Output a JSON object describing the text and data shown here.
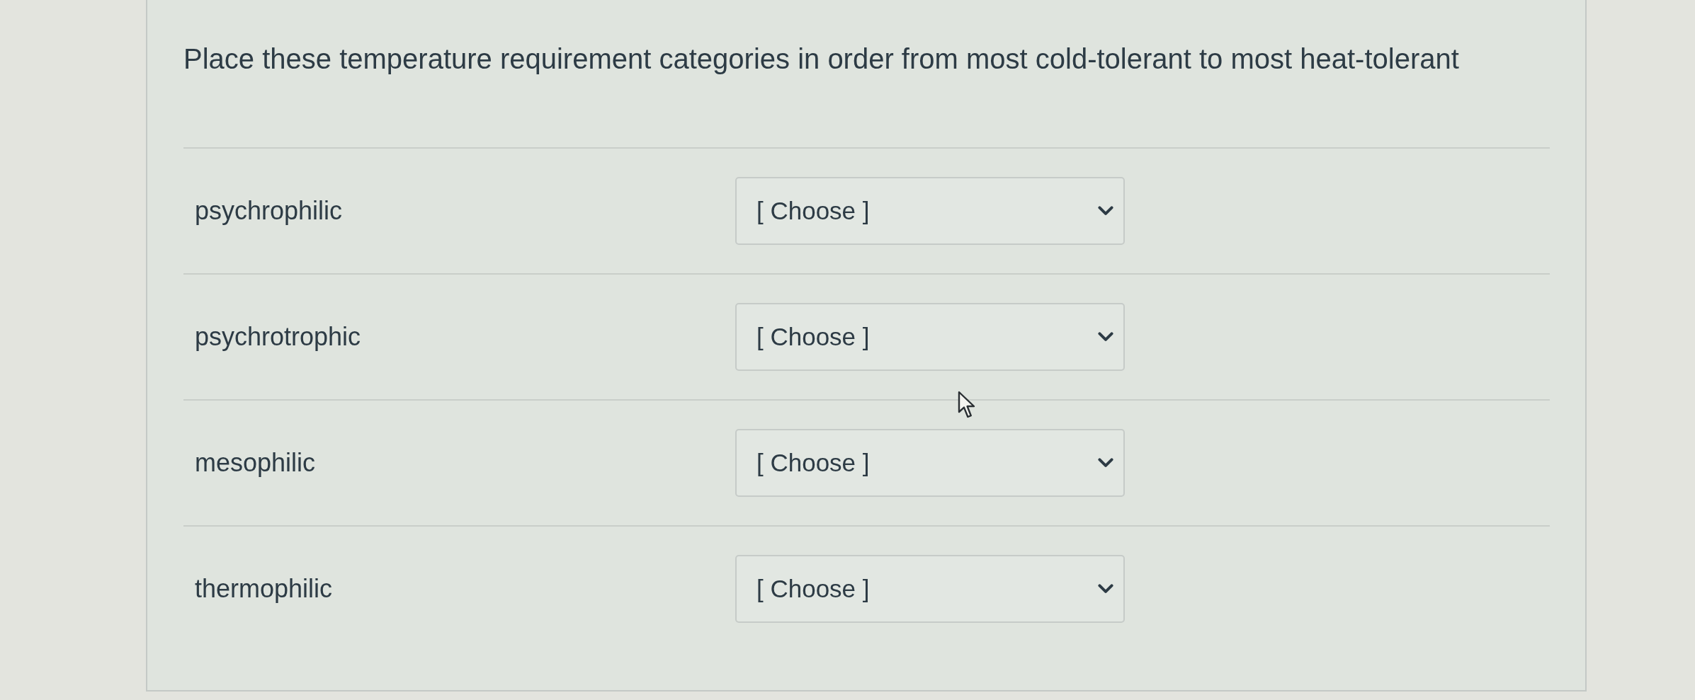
{
  "question": "Place these temperature requirement categories in order from most cold-tolerant to most heat-tolerant",
  "items": [
    {
      "label": "psychrophilic",
      "dropdown": {
        "value": "[ Choose ]"
      }
    },
    {
      "label": "psychrotrophic",
      "dropdown": {
        "value": "[ Choose ]"
      }
    },
    {
      "label": "mesophilic",
      "dropdown": {
        "value": "[ Choose ]"
      }
    },
    {
      "label": "thermophilic",
      "dropdown": {
        "value": "[ Choose ]"
      }
    }
  ]
}
